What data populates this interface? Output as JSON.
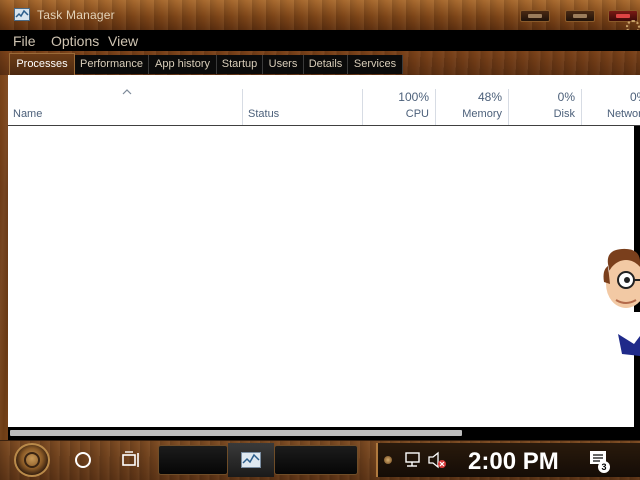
{
  "window": {
    "title": "Task Manager"
  },
  "menu": [
    "File",
    "Options",
    "View"
  ],
  "tabs": [
    "Processes",
    "Performance",
    "App history",
    "Startup",
    "Users",
    "Details",
    "Services"
  ],
  "active_tab": "Processes",
  "columns": {
    "name": "Name",
    "status": "Status",
    "cpu": {
      "percent": "100%",
      "label": "CPU"
    },
    "memory": {
      "percent": "48%",
      "label": "Memory"
    },
    "disk": {
      "percent": "0%",
      "label": "Disk"
    },
    "network": {
      "percent": "0%",
      "label": "Network"
    }
  },
  "taskbar": {
    "clock": "2:00 PM",
    "notification_count": "3"
  },
  "colors": {
    "window_background": "#ffffff",
    "menubar": "#000000",
    "wood": "#7a4519",
    "header_text": "#4c607a"
  }
}
